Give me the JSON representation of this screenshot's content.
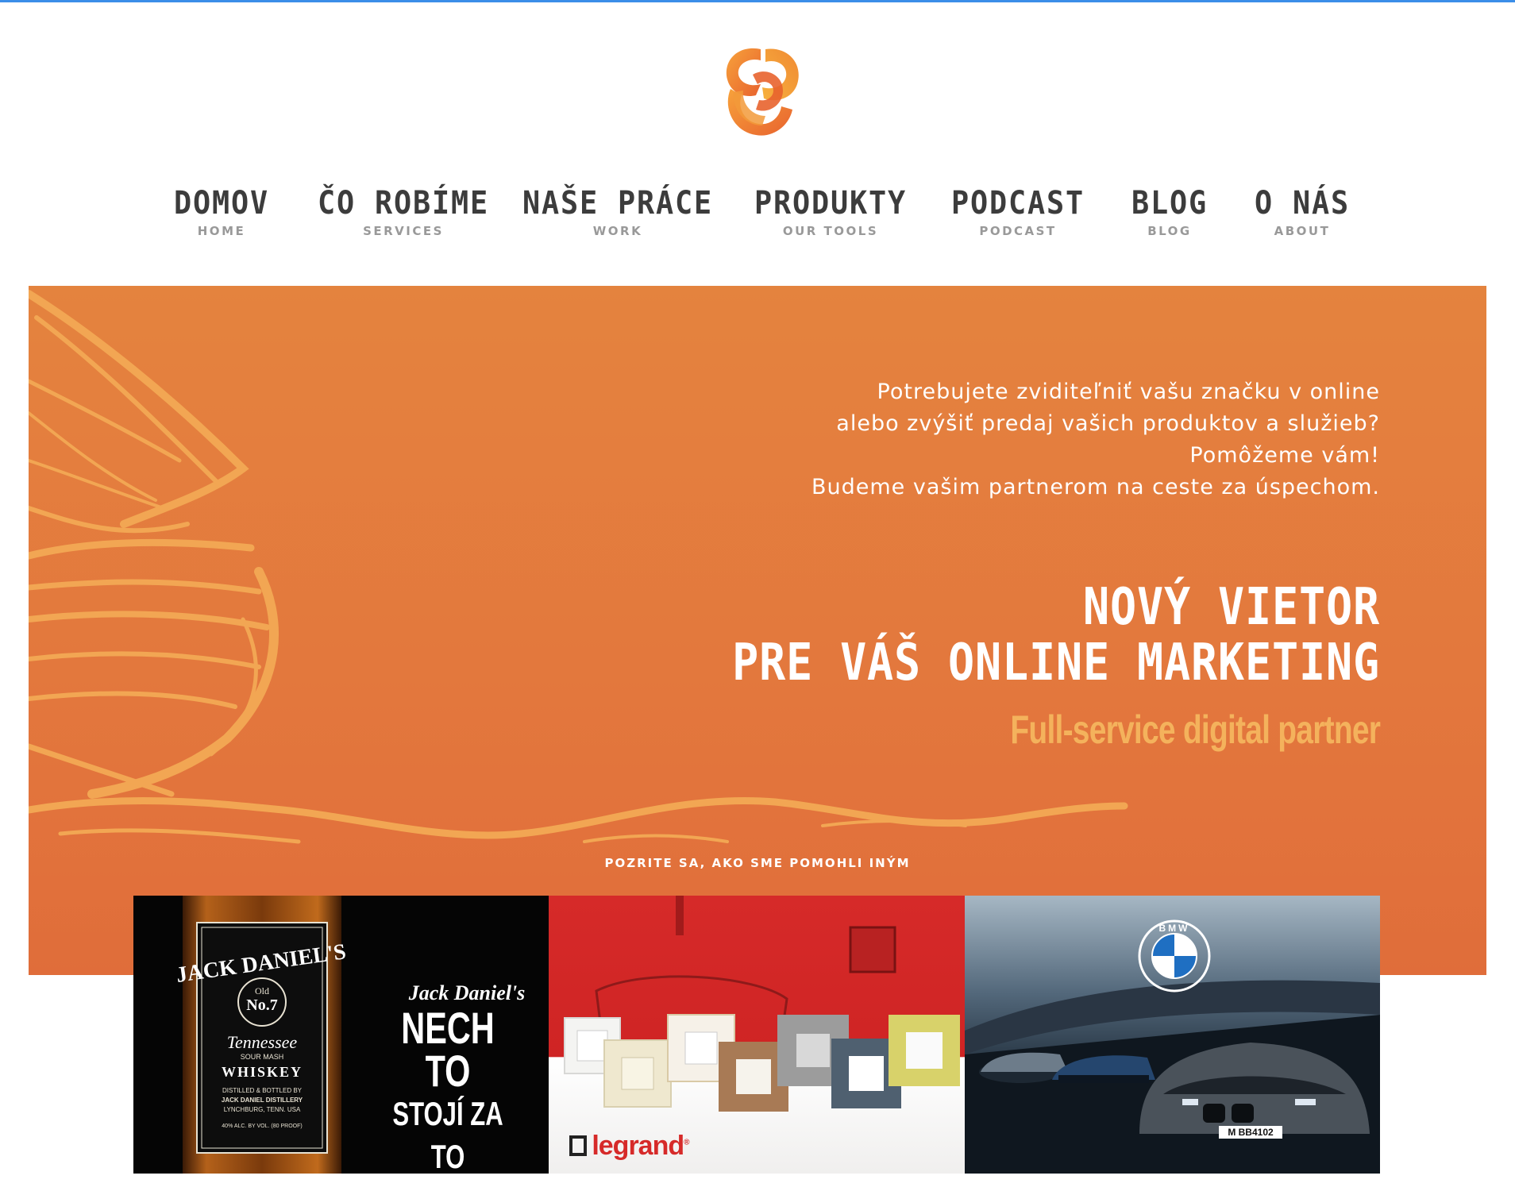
{
  "brand": {
    "logo_colors": [
      "#f7a23b",
      "#e8632e",
      "#f08a33"
    ]
  },
  "nav": {
    "items": [
      {
        "label": "DOMOV",
        "sub": "HOME"
      },
      {
        "label": "ČO ROBÍME",
        "sub": "SERVICES"
      },
      {
        "label": "NAŠE PRÁCE",
        "sub": "WORK"
      },
      {
        "label": "PRODUKTY",
        "sub": "OUR TOOLS"
      },
      {
        "label": "PODCAST",
        "sub": "PODCAST"
      },
      {
        "label": "BLOG",
        "sub": "BLOG"
      },
      {
        "label": "O NÁS",
        "sub": "ABOUT"
      }
    ]
  },
  "hero": {
    "intro": [
      "Potrebujete zviditeľniť vašu značku v online",
      "alebo zvýšiť predaj vašich produktov a služieb?",
      "Pomôžeme vám!",
      "Budeme vašim partnerom na ceste za úspechom."
    ],
    "headline": [
      "NOVÝ VIETOR",
      "PRE VÁŠ ONLINE MARKETING"
    ],
    "tagline": "Full-service digital partner",
    "cta_label": "POZRITE SA, AKO SME POMOHLI INÝM",
    "colors": {
      "background": "#e4833e",
      "tagline": "#f4b25c",
      "art": "#f2a653"
    }
  },
  "gallery": {
    "jack_daniels": {
      "bottle_brand": "JACK DANIEL'S",
      "bottle_label_1": "Old",
      "bottle_label_2": "No.7",
      "bottle_label_3": "Tennessee",
      "bottle_label_4": "SOUR MASH",
      "bottle_label_5": "WHISKEY",
      "bottle_label_6": "DISTILLED & BOTTLED BY",
      "bottle_label_7": "JACK DANIEL DISTILLERY",
      "bottle_label_8": "LYNCHBURG, TENN. USA",
      "bottle_label_9": "40% ALC. BY VOL. (80 PROOF)",
      "side_logo": "Jack Daniel's",
      "slogan_1": "NECH TO",
      "slogan_2": "STOJÍ ZA TO"
    },
    "legrand": {
      "logo": "legrand",
      "registered": "®"
    },
    "bmw": {
      "logo": "BMW",
      "plate_1": "M BB4102"
    }
  }
}
